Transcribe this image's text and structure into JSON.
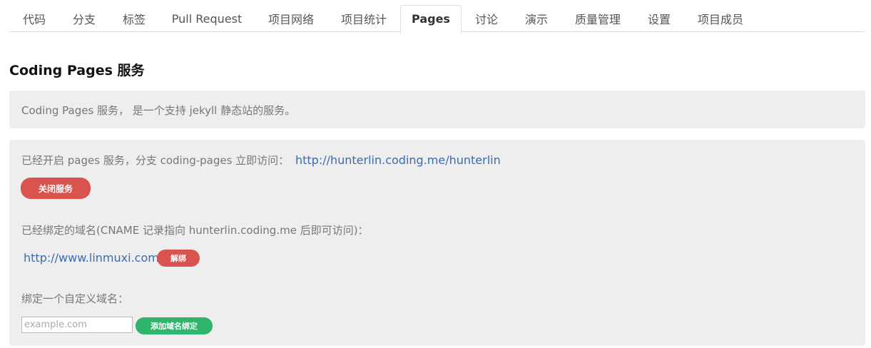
{
  "tabs": [
    {
      "label": "代码"
    },
    {
      "label": "分支"
    },
    {
      "label": "标签"
    },
    {
      "label": "Pull Request"
    },
    {
      "label": "项目网络"
    },
    {
      "label": "项目统计"
    },
    {
      "label": "Pages",
      "active": true
    },
    {
      "label": "讨论"
    },
    {
      "label": "演示"
    },
    {
      "label": "质量管理"
    },
    {
      "label": "设置"
    },
    {
      "label": "项目成员"
    }
  ],
  "page_title": "Coding Pages 服务",
  "intro": {
    "text": "Coding Pages 服务， 是一个支持 jekyll 静态站的服务。"
  },
  "service": {
    "status_text": "已经开启 pages 服务，分支 coding-pages 立即访问：",
    "url": "http://hunterlin.coding.me/hunterlin",
    "disable_label": "关闭服务"
  },
  "bound_domain": {
    "label": "已经绑定的域名(CNAME 记录指向 hunterlin.coding.me 后即可访问)：",
    "domain": "http://www.linmuxi.com",
    "unbind_label": "解绑"
  },
  "custom_domain": {
    "label": "绑定一个自定义域名：",
    "placeholder": "example.com",
    "value": "",
    "add_label": "添加域名绑定"
  },
  "colors": {
    "danger": "#d9534f",
    "success": "#2fb56b",
    "link": "#3a6bb4",
    "panel": "#eeeeee"
  }
}
